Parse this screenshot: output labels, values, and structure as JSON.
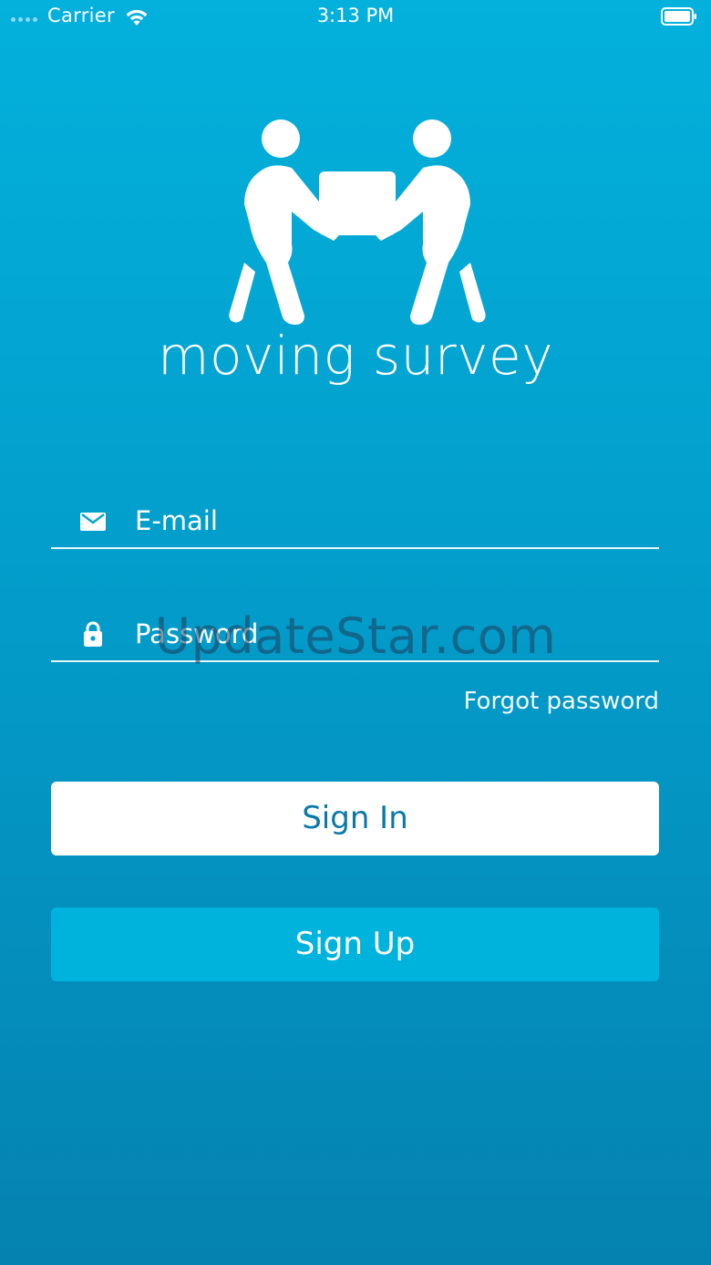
{
  "status_bar": {
    "carrier": "Carrier",
    "time": "3:13 PM"
  },
  "brand": {
    "name": "moving survey",
    "logo_icon": "two-people-carrying-box-icon"
  },
  "form": {
    "email": {
      "placeholder": "E-mail",
      "icon": "mail-icon"
    },
    "password": {
      "placeholder": "Password",
      "icon": "lock-icon"
    },
    "forgot_password": "Forgot password"
  },
  "buttons": {
    "sign_in": "Sign In",
    "sign_up": "Sign Up"
  },
  "watermark": "UpdateStar.com",
  "colors": {
    "background_top": "#03b1dc",
    "background_bottom": "#0582b0",
    "sign_in_bg": "#ffffff",
    "sign_in_text": "#0a79a8",
    "sign_up_bg": "#00b3dd"
  }
}
